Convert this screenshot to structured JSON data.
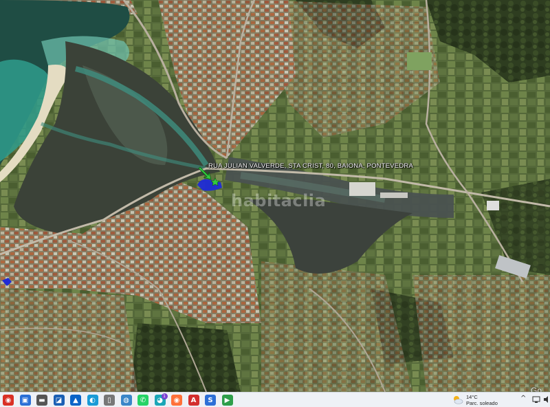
{
  "map": {
    "place_label": "RUA JULIAN VALVERDE, STA CRIST, 80, BAIONA, PONTEVEDRA",
    "watermark": "habitaclia",
    "corner_text": "Go",
    "marker_color": "#1f2bd6",
    "arrow_color": "#34c93e"
  },
  "taskbar": {
    "apps": [
      {
        "name": "chrome-icon",
        "glyph": "◉",
        "color": "#d93025"
      },
      {
        "name": "app-icon",
        "glyph": "▣",
        "color": "#2a6fd6"
      },
      {
        "name": "explorer-icon",
        "glyph": "▬",
        "color": "#555555"
      },
      {
        "name": "app-icon-2",
        "glyph": "◪",
        "color": "#1a5fb4"
      },
      {
        "name": "photos-icon",
        "glyph": "▲",
        "color": "#0a64c8"
      },
      {
        "name": "edge-icon",
        "glyph": "◐",
        "color": "#1a9bd6"
      },
      {
        "name": "file-icon",
        "glyph": "▯",
        "color": "#777777"
      },
      {
        "name": "globe-icon",
        "glyph": "◍",
        "color": "#3a86c8"
      },
      {
        "name": "whatsapp-icon",
        "glyph": "✆",
        "color": "#25d366"
      },
      {
        "name": "app-icon-3",
        "glyph": "◕",
        "color": "#1aa6b7"
      },
      {
        "name": "firefox-icon",
        "glyph": "◉",
        "color": "#ff7139"
      },
      {
        "name": "acrobat-icon",
        "glyph": "A",
        "color": "#d32f2f"
      },
      {
        "name": "app-icon-4",
        "glyph": "S",
        "color": "#2d6fd6"
      },
      {
        "name": "app-icon-5",
        "glyph": "▶",
        "color": "#2e9e4a"
      }
    ],
    "badge": "1",
    "weather": {
      "temp": "14°C",
      "desc": "Parc. soleado"
    }
  }
}
